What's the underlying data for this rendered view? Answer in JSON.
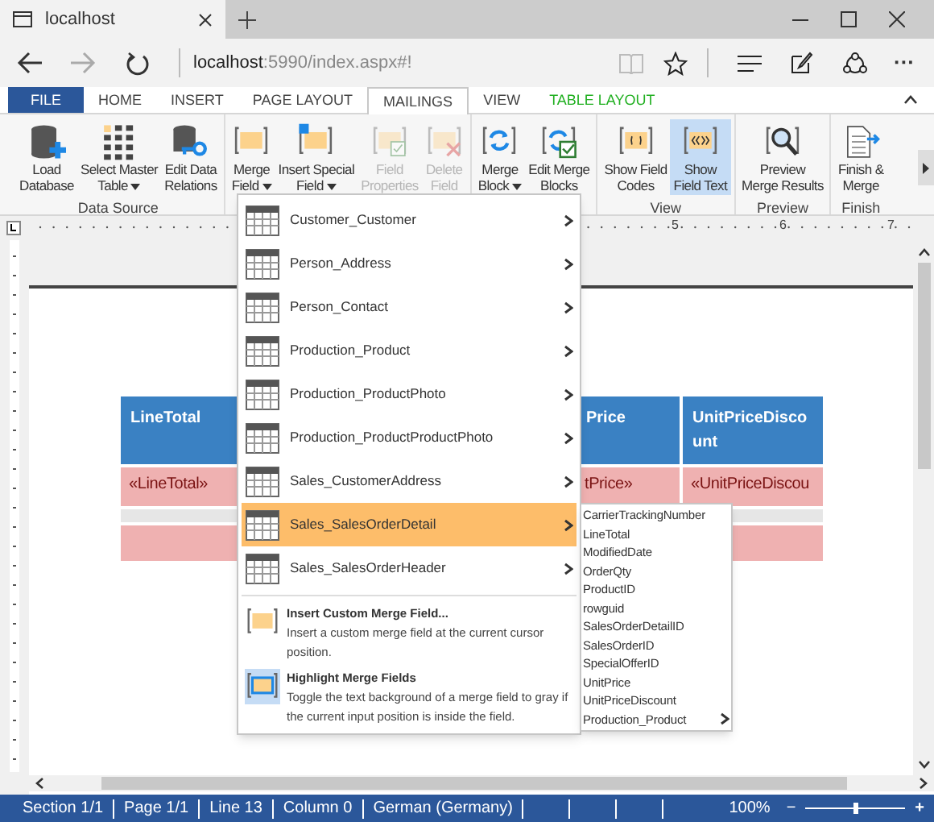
{
  "browser": {
    "tab_title": "localhost",
    "url_host": "localhost",
    "url_rest": ":5990/index.aspx#!",
    "more": "···"
  },
  "ribbon_tabs": [
    {
      "label": "FILE",
      "kind": "file",
      "selected": false
    },
    {
      "label": "HOME",
      "kind": "plain",
      "selected": false
    },
    {
      "label": "INSERT",
      "kind": "plain",
      "selected": false
    },
    {
      "label": "PAGE LAYOUT",
      "kind": "plain",
      "selected": false
    },
    {
      "label": "MAILINGS",
      "kind": "plain",
      "selected": true
    },
    {
      "label": "VIEW",
      "kind": "plain",
      "selected": false
    },
    {
      "label": "TABLE LAYOUT",
      "kind": "context",
      "selected": false
    }
  ],
  "ribbon_groups": [
    {
      "label": "Data Source",
      "buttons": [
        {
          "label": "Load\nDatabase",
          "dropdown": false,
          "disabled": false,
          "selected": false
        },
        {
          "label": "Select Master\nTable",
          "dropdown": true,
          "disabled": false,
          "selected": false
        },
        {
          "label": "Edit Data\nRelations",
          "dropdown": false,
          "disabled": false,
          "selected": false
        }
      ]
    },
    {
      "buttons": [
        {
          "label": "Merge\nField",
          "dropdown": true,
          "disabled": false,
          "selected": false
        },
        {
          "label": "Insert Special\nField",
          "dropdown": true,
          "disabled": false,
          "selected": false
        },
        {
          "label": "Field\nProperties",
          "dropdown": false,
          "disabled": true,
          "selected": false
        },
        {
          "label": "Delete\nField",
          "dropdown": false,
          "disabled": true,
          "selected": false
        }
      ]
    },
    {
      "buttons": [
        {
          "label": "Merge\nBlock",
          "dropdown": true,
          "disabled": false,
          "selected": false
        },
        {
          "label": "Edit Merge\nBlocks",
          "dropdown": false,
          "disabled": false,
          "selected": false
        }
      ]
    },
    {
      "label": "View",
      "buttons": [
        {
          "label": "Show Field\nCodes",
          "dropdown": false,
          "disabled": false,
          "selected": false
        },
        {
          "label": "Show\nField Text",
          "dropdown": false,
          "disabled": false,
          "selected": true
        }
      ]
    },
    {
      "label": "Preview",
      "buttons": [
        {
          "label": "Preview\nMerge Results",
          "dropdown": false,
          "disabled": false,
          "selected": false
        }
      ]
    },
    {
      "label": "Finish",
      "buttons": [
        {
          "label": "Finish &\nMerge",
          "dropdown": false,
          "disabled": false,
          "selected": false
        }
      ]
    }
  ],
  "ruler": {
    "labels": [
      "5",
      "6",
      "7"
    ]
  },
  "table": {
    "columns": [
      "LineTotal",
      "",
      "Price",
      "UnitPriceDiscount"
    ],
    "rows": [
      {
        "kind": "field",
        "cells": [
          "«LineTotal»",
          "",
          "tPrice»",
          "«UnitPriceDiscou"
        ]
      },
      {
        "kind": "blank",
        "cells": [
          "",
          "",
          "",
          ""
        ]
      },
      {
        "kind": "field",
        "cells": [
          "",
          "",
          "",
          ""
        ]
      }
    ]
  },
  "merge_menu": {
    "tables": [
      {
        "label": "Customer_Customer",
        "selected": false
      },
      {
        "label": "Person_Address",
        "selected": false
      },
      {
        "label": "Person_Contact",
        "selected": false
      },
      {
        "label": "Production_Product",
        "selected": false
      },
      {
        "label": "Production_ProductPhoto",
        "selected": false
      },
      {
        "label": "Production_ProductProductPhoto",
        "selected": false
      },
      {
        "label": "Sales_CustomerAddress",
        "selected": false
      },
      {
        "label": "Sales_SalesOrderDetail",
        "selected": true
      },
      {
        "label": "Sales_SalesOrderHeader",
        "selected": false
      }
    ],
    "commands": [
      {
        "title": "Insert Custom Merge Field...",
        "description": "Insert a custom merge field at the current cursor position."
      },
      {
        "title": "Highlight Merge Fields",
        "description": "Toggle the text background of a merge field to gray if the current input position is inside the field."
      }
    ]
  },
  "submenu": [
    {
      "label": "CarrierTrackingNumber",
      "has_children": false
    },
    {
      "label": "LineTotal",
      "has_children": false
    },
    {
      "label": "ModifiedDate",
      "has_children": false
    },
    {
      "label": "OrderQty",
      "has_children": false
    },
    {
      "label": "ProductID",
      "has_children": false
    },
    {
      "label": "rowguid",
      "has_children": false
    },
    {
      "label": "SalesOrderDetailID",
      "has_children": false
    },
    {
      "label": "SalesOrderID",
      "has_children": false
    },
    {
      "label": "SpecialOfferID",
      "has_children": false
    },
    {
      "label": "UnitPrice",
      "has_children": false
    },
    {
      "label": "UnitPriceDiscount",
      "has_children": false
    },
    {
      "label": "Production_Product",
      "has_children": true
    }
  ],
  "status_bar": {
    "items": [
      "Section 1/1",
      "Page 1/1",
      "Line 13",
      "Column 0",
      "German (Germany)"
    ],
    "zoom": "100%",
    "minus": "−",
    "plus": "+",
    "level": 0.5
  }
}
